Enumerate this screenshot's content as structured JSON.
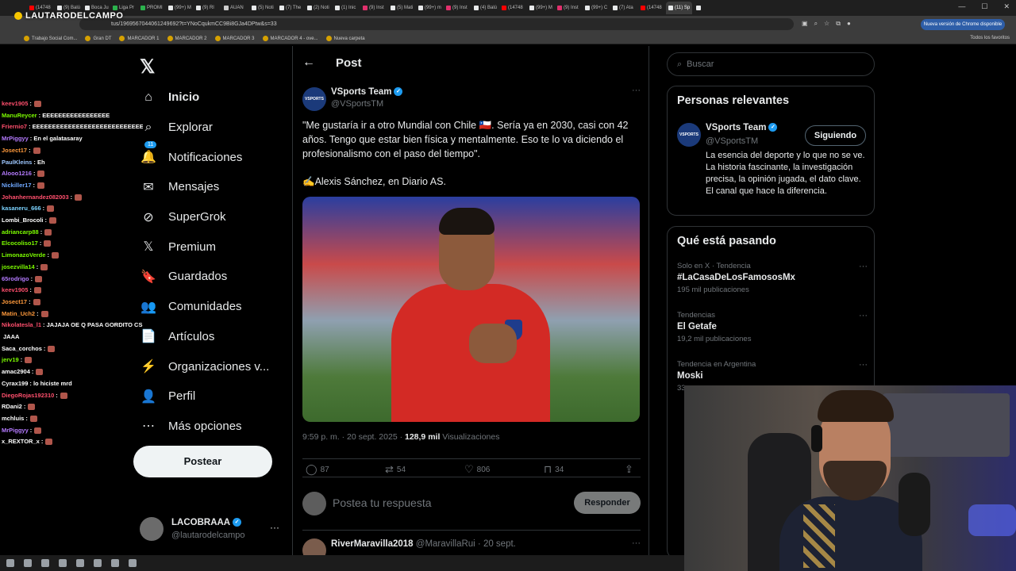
{
  "browser": {
    "tabs": [
      {
        "label": "(14748",
        "color": "#ff0000"
      },
      {
        "label": "(9) Balú",
        "color": "#e7e9ea"
      },
      {
        "label": "Boca Ju",
        "color": "#e7e9ea"
      },
      {
        "label": "Liga Pr",
        "color": "#2bb24c"
      },
      {
        "label": "PROMI",
        "color": "#2bb24c"
      },
      {
        "label": "(99+) M",
        "color": "#e7e9ea"
      },
      {
        "label": "(9) Rl",
        "color": "#e7e9ea"
      },
      {
        "label": "AUAN",
        "color": "#cccccc"
      },
      {
        "label": "(5) Noti",
        "color": "#e7e9ea"
      },
      {
        "label": "(7) The",
        "color": "#e7e9ea"
      },
      {
        "label": "(2) Noti",
        "color": "#e7e9ea"
      },
      {
        "label": "(1) Inic",
        "color": "#e7e9ea"
      },
      {
        "label": "(9) Inst",
        "color": "#e1306c"
      },
      {
        "label": "(5) Mati",
        "color": "#e7e9ea"
      },
      {
        "label": "(99+) m",
        "color": "#e7e9ea"
      },
      {
        "label": "(9) Inst",
        "color": "#e1306c"
      },
      {
        "label": "(4) Balú",
        "color": "#e7e9ea"
      },
      {
        "label": "(14748",
        "color": "#ff0000"
      },
      {
        "label": "(99+) M",
        "color": "#e7e9ea"
      },
      {
        "label": "(9) Inst",
        "color": "#e1306c"
      },
      {
        "label": "(99+) C",
        "color": "#e7e9ea"
      },
      {
        "label": "(7) Ata",
        "color": "#e7e9ea"
      },
      {
        "label": "(14748",
        "color": "#ff0000"
      },
      {
        "label": "(11) Sp",
        "color": "#e7e9ea"
      },
      {
        "label": "",
        "color": "#e7e9ea"
      }
    ],
    "url": "tus/1969567044061249692?t=YNoCqukmCC9Bi8GJa4DPtw&s=33",
    "update_label": "Nueva versión de Chrome disponible",
    "bookmarks": [
      "Trabajo Social Com...",
      "Gran DT",
      "MARCADOR 1",
      "MARCADOR 2",
      "MARCADOR 3",
      "MARCADOR 4 - ove...",
      "Nueva carpeta"
    ],
    "bookmarks_right": "Todos los favoritos"
  },
  "stream": {
    "logo": "LAUTARODELCAMPO"
  },
  "chat": [
    {
      "user": "keev1905",
      "color": "#ff4f6d",
      "msg": ":"
    },
    {
      "user": "ManuReycer",
      "color": "#7cfc00",
      "msg": ": EEEEEEEEEEEEEEEEE"
    },
    {
      "user": "Friernio7",
      "color": "#ff4f6d",
      "msg": ": EEEEEEEEEEEEEEEEEEEEEEEEEEEEE"
    },
    {
      "user": "MrPiggyy",
      "color": "#b57bff",
      "msg": ": En el galatasaray"
    },
    {
      "user": "Josect17",
      "color": "#ff9a3c",
      "msg": ":"
    },
    {
      "user": "PaulKleins",
      "color": "#9ec7ff",
      "msg": ": Eh"
    },
    {
      "user": "Alooo1216",
      "color": "#b57bff",
      "msg": ":"
    },
    {
      "user": "Nickiller17",
      "color": "#6fa8ff",
      "msg": ":"
    },
    {
      "user": "Johanhernandez082003",
      "color": "#ff4f6d",
      "msg": ":"
    },
    {
      "user": "kasaneru_666",
      "color": "#7cd3ff",
      "msg": ":"
    },
    {
      "user": "Lombi_Brocoli",
      "color": "#ffffff",
      "msg": ":"
    },
    {
      "user": "adriancarp88",
      "color": "#7cfc00",
      "msg": ":"
    },
    {
      "user": "Elcocoliso17",
      "color": "#7cfc00",
      "msg": ":"
    },
    {
      "user": "LimonazoVerde",
      "color": "#7cfc00",
      "msg": ":"
    },
    {
      "user": "josezvilla14",
      "color": "#7cfc00",
      "msg": ":"
    },
    {
      "user": "65rodrigo",
      "color": "#b57bff",
      "msg": ":"
    },
    {
      "user": "keev1905",
      "color": "#ff4f6d",
      "msg": ":"
    },
    {
      "user": "Josect17",
      "color": "#ff9a3c",
      "msg": ":"
    },
    {
      "user": "Matin_Uch2",
      "color": "#ff9a3c",
      "msg": ":"
    },
    {
      "user": "Nikolatesla_l1",
      "color": "#ff4f6d",
      "msg": ": JAJAJA OE Q PASA GORDITO CSMRE Q FUJE X"
    },
    {
      "user": "",
      "color": "#ffffff",
      "msg": "JAAA"
    },
    {
      "user": "Saca_corchos",
      "color": "#ffffff",
      "msg": ":"
    },
    {
      "user": "jerv19",
      "color": "#7cfc00",
      "msg": ":"
    },
    {
      "user": "amac2904",
      "color": "#ffffff",
      "msg": ":"
    },
    {
      "user": "Cyrax199",
      "color": "#ffffff",
      "msg": ": lo hiciste mrd"
    },
    {
      "user": "DiegoRojas192310",
      "color": "#ff4f6d",
      "msg": ":"
    },
    {
      "user": "RDani2",
      "color": "#ffffff",
      "msg": ":"
    },
    {
      "user": "mchluis",
      "color": "#ffffff",
      "msg": ":"
    },
    {
      "user": "MrPiggyy",
      "color": "#b57bff",
      "msg": ":"
    },
    {
      "user": "x_REXTOR_x",
      "color": "#ffffff",
      "msg": ":"
    }
  ],
  "nav": {
    "items": [
      {
        "label": "Inicio",
        "icon": "⌂",
        "name": "home-icon"
      },
      {
        "label": "Explorar",
        "icon": "⌕",
        "name": "search-icon"
      },
      {
        "label": "Notificaciones",
        "icon": "🔔",
        "name": "bell-icon"
      },
      {
        "label": "Mensajes",
        "icon": "✉",
        "name": "mail-icon"
      },
      {
        "label": "SuperGrok",
        "icon": "⊘",
        "name": "grok-icon"
      },
      {
        "label": "Premium",
        "icon": "𝕏",
        "name": "x-premium-icon"
      },
      {
        "label": "Guardados",
        "icon": "🔖",
        "name": "bookmark-icon"
      },
      {
        "label": "Comunidades",
        "icon": "👥",
        "name": "communities-icon"
      },
      {
        "label": "Artículos",
        "icon": "📄",
        "name": "articles-icon"
      },
      {
        "label": "Organizaciones v...",
        "icon": "⚡",
        "name": "lightning-icon"
      },
      {
        "label": "Perfil",
        "icon": "👤",
        "name": "profile-icon"
      },
      {
        "label": "Más opciones",
        "icon": "⋯",
        "name": "more-options-icon"
      }
    ],
    "notif_badge": "11",
    "post_button": "Postear",
    "account": {
      "name": "LACOBRAAA",
      "handle": "@lautarodelcampo"
    }
  },
  "post": {
    "header_title": "Post",
    "author_name": "VSports Team",
    "author_handle": "@VSportsTM",
    "avatar_text": "VSPORTS",
    "text": "\"Me gustaría ir a otro Mundial con Chile 🇨🇱. Sería ya en 2030, casi con 42 años. Tengo que estar bien física y mentalmente. Eso te lo va diciendo el profesionalismo con el paso del tiempo\".",
    "signature": "✍️Alexis Sánchez, en Diario AS.",
    "time": "9:59 p. m. · 20 sept. 2025 ·",
    "views_count": "128,9 mil",
    "views_label": "Visualizaciones",
    "replies": "87",
    "reposts": "54",
    "likes": "806",
    "bookmarks": "34",
    "reply_placeholder": "Postea tu respuesta",
    "reply_button": "Responder",
    "comment_author": "RiverMaravilla2018",
    "comment_handle": "@MaravillaRui · 20 sept."
  },
  "right": {
    "search_placeholder": "Buscar",
    "relevant_title": "Personas relevantes",
    "relevant": {
      "name": "VSports Team",
      "handle": "@VSportsTM",
      "follow_label": "Siguiendo",
      "bio": "La esencia del deporte y lo que no se ve. La historia fascinante, la investigación precisa, la opinión jugada, el dato clave. El canal que hace la diferencia."
    },
    "trends_title": "Qué está pasando",
    "trends": [
      {
        "context": "Solo en X · Tendencia",
        "title": "#LaCasaDeLosFamososMx",
        "count": "195 mil publicaciones"
      },
      {
        "context": "Tendencias",
        "title": "El Getafe",
        "count": "19,2 mil publicaciones"
      },
      {
        "context": "Tendencia en Argentina",
        "title": "Moski",
        "count": "33"
      }
    ]
  }
}
